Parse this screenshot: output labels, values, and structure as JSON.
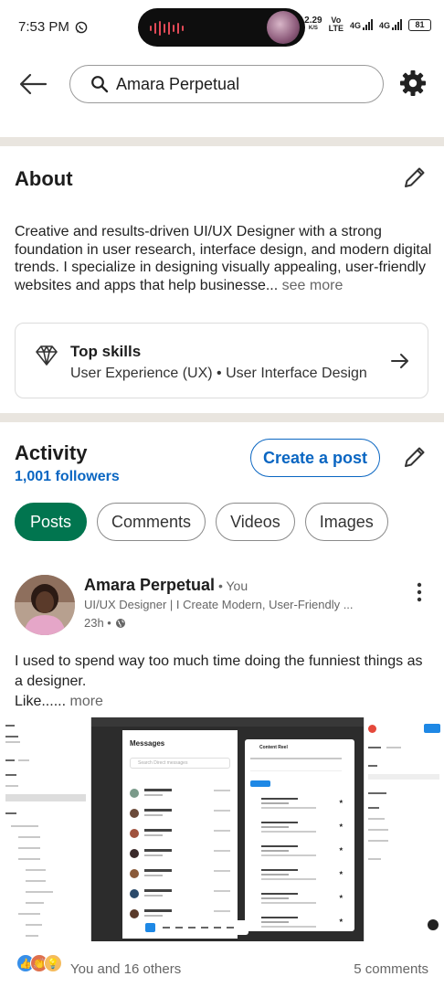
{
  "status_bar": {
    "time": "7:53 PM",
    "speed": "2.29",
    "speed_unit": "K/S",
    "vo": "Vo",
    "lte": "LTE",
    "net1": "4G",
    "net2": "4G",
    "battery": "81"
  },
  "header": {
    "search_value": "Amara Perpetual"
  },
  "about": {
    "title": "About",
    "text": "Creative and results-driven UI/UX Designer with a strong foundation in user research, interface design, and modern digital trends. I specialize in designing visually appealing, user-friendly websites and apps that help businesse...",
    "see_more": "see more"
  },
  "top_skills": {
    "title": "Top skills",
    "skills": "User Experience (UX) • User Interface Design"
  },
  "activity": {
    "title": "Activity",
    "followers": "1,001 followers",
    "create_post": "Create a post",
    "chips": [
      "Posts",
      "Comments",
      "Videos",
      "Images"
    ],
    "active_chip": "Posts"
  },
  "post": {
    "author": "Amara Perpetual",
    "you_label": " • You",
    "headline": "UI/UX Designer | I Create Modern, User-Friendly ...",
    "time": "23h •",
    "text_line1": "I used to spend way too much time doing the funniest things as a designer.",
    "text_line2": "Like......",
    "more": "more",
    "image": {
      "messages_title": "Messages",
      "search_placeholder": "Search Direct messages",
      "content_title": "Content Reel"
    },
    "reactions_text": "You and 16 others",
    "comments": "5 comments"
  },
  "colors": {
    "accent_blue": "#0a66c2",
    "chip_active": "#01754f",
    "divider": "#e9e5df"
  },
  "icons": {
    "back": "arrow-left-icon",
    "search": "search-icon",
    "settings": "gear-icon",
    "edit": "pencil-icon",
    "skills": "diamond-icon",
    "arrow": "arrow-right-icon",
    "more": "more-vertical-icon",
    "visibility": "globe-icon",
    "whatsapp": "whatsapp-icon"
  }
}
